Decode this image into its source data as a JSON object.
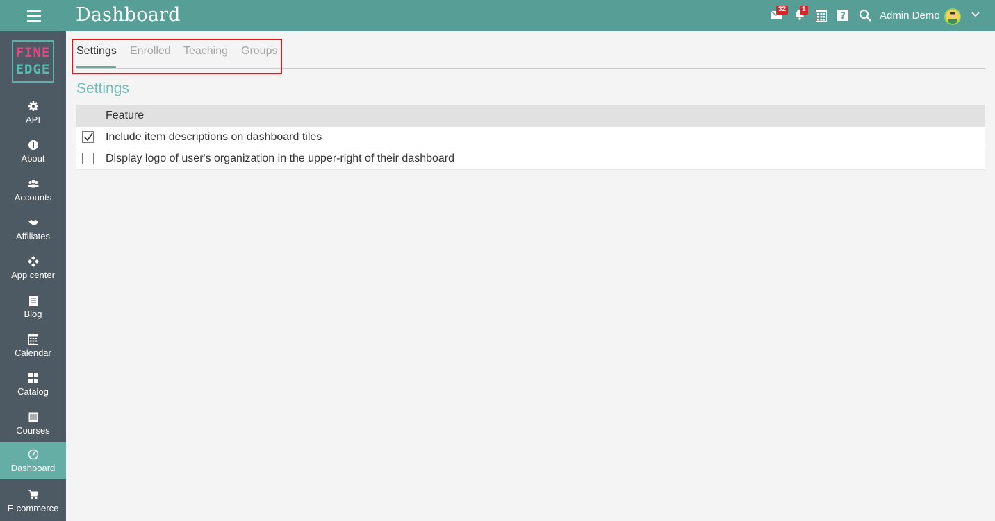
{
  "header": {
    "title": "Dashboard",
    "messages_badge": "32",
    "notifications_badge": "1",
    "user_name": "Admin Demo"
  },
  "sidebar": {
    "logo_line1": "FINE",
    "logo_line2": "EDGE",
    "items": [
      {
        "label": "API",
        "icon": "gear-icon"
      },
      {
        "label": "About",
        "icon": "info-icon"
      },
      {
        "label": "Accounts",
        "icon": "users-icon"
      },
      {
        "label": "Affiliates",
        "icon": "handshake-icon"
      },
      {
        "label": "App center",
        "icon": "diamonds-icon"
      },
      {
        "label": "Blog",
        "icon": "blog-icon"
      },
      {
        "label": "Calendar",
        "icon": "calendar-icon"
      },
      {
        "label": "Catalog",
        "icon": "grid-icon"
      },
      {
        "label": "Courses",
        "icon": "courses-icon"
      },
      {
        "label": "Dashboard",
        "icon": "dashboard-icon",
        "active": true
      },
      {
        "label": "E-commerce",
        "icon": "cart-icon"
      }
    ]
  },
  "tabs": [
    {
      "label": "Settings",
      "active": true
    },
    {
      "label": "Enrolled"
    },
    {
      "label": "Teaching"
    },
    {
      "label": "Groups"
    }
  ],
  "section": {
    "title": "Settings",
    "column_header": "Feature",
    "rows": [
      {
        "label": "Include item descriptions on dashboard tiles",
        "checked": true
      },
      {
        "label": "Display logo of user's organization in the upper-right of their dashboard",
        "checked": false
      }
    ]
  },
  "colors": {
    "topbar": "#579e97",
    "sidebar": "#4d5a63",
    "active_nav": "#64aea6",
    "accent_title": "#6cc0bb",
    "badge": "#d6262a"
  }
}
